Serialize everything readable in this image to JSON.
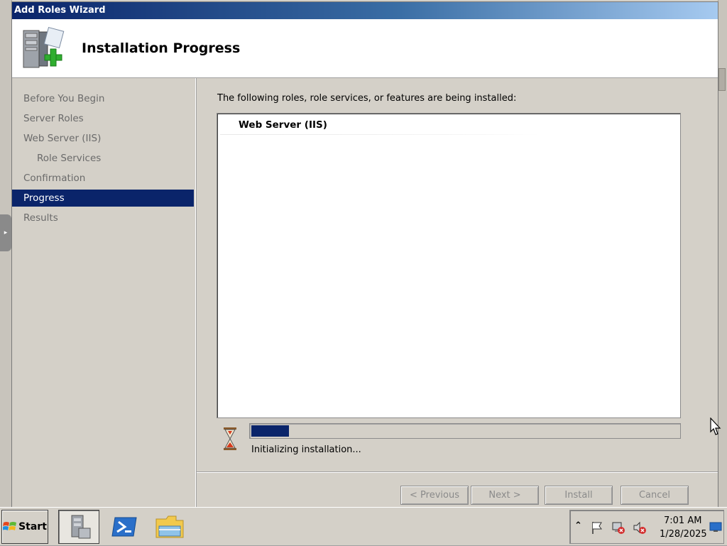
{
  "window": {
    "title": "Add Roles Wizard",
    "header_title": "Installation Progress"
  },
  "sidebar": {
    "steps": [
      {
        "label": "Before You Begin"
      },
      {
        "label": "Server Roles"
      },
      {
        "label": "Web Server (IIS)"
      },
      {
        "label": "Role Services"
      },
      {
        "label": "Confirmation"
      },
      {
        "label": "Progress"
      },
      {
        "label": "Results"
      }
    ],
    "active_step": "Progress"
  },
  "main": {
    "intro": "The following roles, role services, or features are being installed:",
    "roles": [
      {
        "label": "Web Server (IIS)"
      }
    ],
    "progress_fraction": 0.09,
    "status": "Initializing installation..."
  },
  "buttons": {
    "previous": "< Previous",
    "next": "Next >",
    "install": "Install",
    "cancel": "Cancel"
  },
  "taskbar": {
    "start_label": "Start",
    "apps": [
      {
        "name": "server-manager-icon",
        "active": true
      },
      {
        "name": "powershell-icon",
        "active": false
      },
      {
        "name": "explorer-folder-icon",
        "active": false
      }
    ],
    "tray_icons": [
      "show-hidden-icons-chevron",
      "action-center-flag-icon",
      "network-disconnected-icon",
      "speaker-muted-icon"
    ],
    "time": "7:01 AM",
    "date": "1/28/2025"
  },
  "colors": {
    "accent": "#0a246a",
    "window_bg": "#d4d0c8",
    "disabled_text": "#8a8a8a"
  }
}
